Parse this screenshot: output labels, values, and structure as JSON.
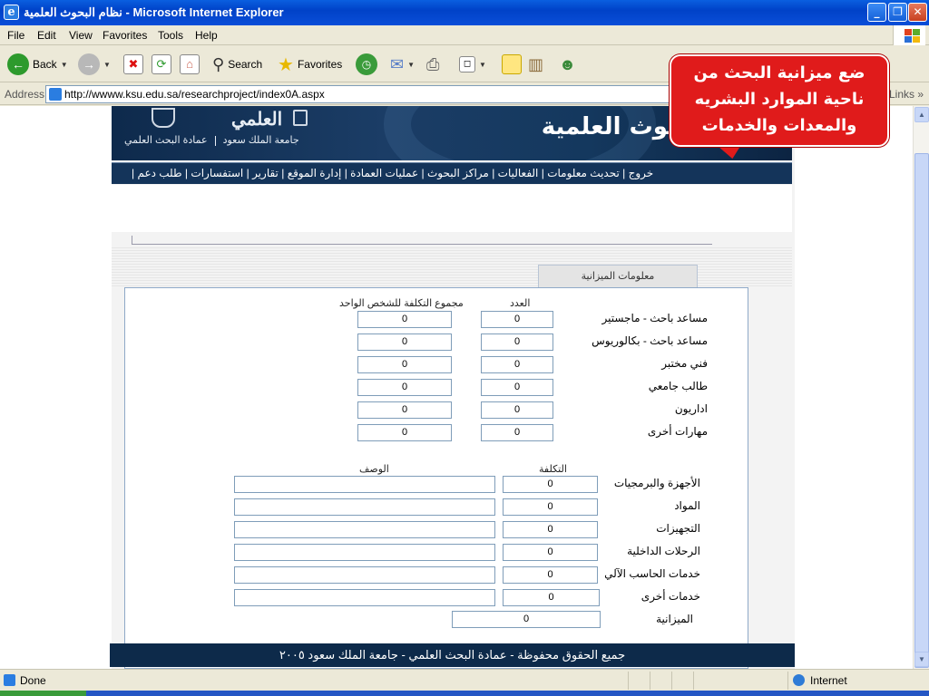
{
  "window": {
    "title": "نظام البحوث العلمية - Microsoft Internet Explorer"
  },
  "menu": [
    "File",
    "Edit",
    "View",
    "Favorites",
    "Tools",
    "Help"
  ],
  "toolbar": {
    "back": "Back",
    "search": "Search",
    "favorites": "Favorites"
  },
  "address": {
    "label": "Address",
    "url": "http://wwww.ksu.edu.sa/researchproject/index0A.aspx",
    "go": "Go",
    "links": "Links"
  },
  "banner": {
    "logo_text": "العلمي",
    "deanship": "عمادة البحث العلمي",
    "university": "جامعة الملك سعود",
    "system_title": "نظام البحوث العلمية"
  },
  "nav": [
    "خروج",
    "تحديث معلومات",
    "الفعاليات",
    "مراكز البحوث",
    "عمليات العمادة",
    "إدارة الموقع",
    "تقارير",
    "استفسارات",
    "طلب دعم"
  ],
  "callout": {
    "line1": "ضع ميزانية البحث من",
    "line2": "ناحية الموارد البشريه",
    "line3": "والمعدات والخدمات"
  },
  "tab": {
    "label": "معلومات الميزانية"
  },
  "staff": {
    "col_count": "العدد",
    "col_total": "مجموع التكلفة للشخص الواحد",
    "rows": [
      {
        "label": "مساعد باحث - ماجستير",
        "count": "0",
        "total": "0"
      },
      {
        "label": "مساعد باحث - بكالوريوس",
        "count": "0",
        "total": "0"
      },
      {
        "label": "فني مختبر",
        "count": "0",
        "total": "0"
      },
      {
        "label": "طالب جامعي",
        "count": "0",
        "total": "0"
      },
      {
        "label": "اداريون",
        "count": "0",
        "total": "0"
      },
      {
        "label": "مهارات أخرى",
        "count": "0",
        "total": "0"
      }
    ]
  },
  "expenses": {
    "col_cost": "التكلفة",
    "col_desc": "الوصف",
    "rows": [
      {
        "label": "الأجهزة والبرمجيات",
        "cost": "0",
        "desc": ""
      },
      {
        "label": "المواد",
        "cost": "0",
        "desc": ""
      },
      {
        "label": "التجهيزات",
        "cost": "0",
        "desc": ""
      },
      {
        "label": "الرحلات الداخلية",
        "cost": "0",
        "desc": ""
      },
      {
        "label": "خدمات الحاسب الآلي",
        "cost": "0",
        "desc": ""
      },
      {
        "label": "خدمات أخرى",
        "cost": "0",
        "desc": ""
      }
    ],
    "budget_label": "الميزانية",
    "budget_value": "0"
  },
  "footer": {
    "text": "جميع الحقوق محفوظة - عمادة البحث العلمي - جامعة الملك سعود ٢٠٠٥"
  },
  "status": {
    "text": "Done",
    "zone": "Internet"
  }
}
